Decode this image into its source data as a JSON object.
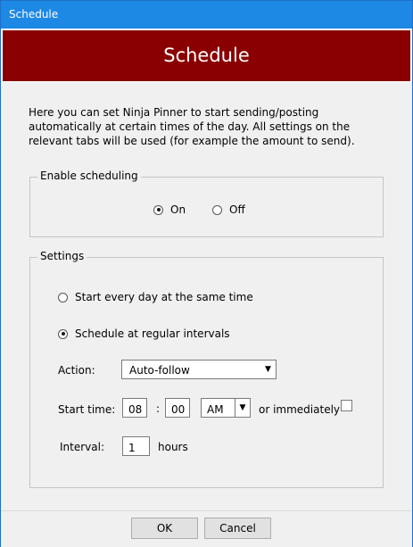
{
  "window": {
    "title": "Schedule"
  },
  "header": {
    "title": "Schedule"
  },
  "description": "Here you can set Ninja Pinner to start sending/posting automatically at certain times of the day. All settings on the relevant tabs will be used (for example the amount to send).",
  "enable_group": {
    "legend": "Enable scheduling",
    "on_label": "On",
    "off_label": "Off",
    "selected": "On"
  },
  "settings_group": {
    "legend": "Settings",
    "mode_daily_label": "Start every day at the same time",
    "mode_interval_label": "Schedule at regular intervals",
    "selected_mode": "interval",
    "action_label": "Action:",
    "action_value": "Auto-follow",
    "start_time_label": "Start time:",
    "hour": "08",
    "minute": "00",
    "colon": ":",
    "ampm": "AM",
    "immediately_label": "or immediately",
    "immediately_checked": false,
    "interval_label": "Interval:",
    "interval_value": "1",
    "interval_unit": "hours"
  },
  "footer": {
    "ok_label": "OK",
    "cancel_label": "Cancel"
  },
  "colors": {
    "titlebar": "#1e88e5",
    "banner": "#8a0000",
    "background": "#f0f0f0"
  }
}
